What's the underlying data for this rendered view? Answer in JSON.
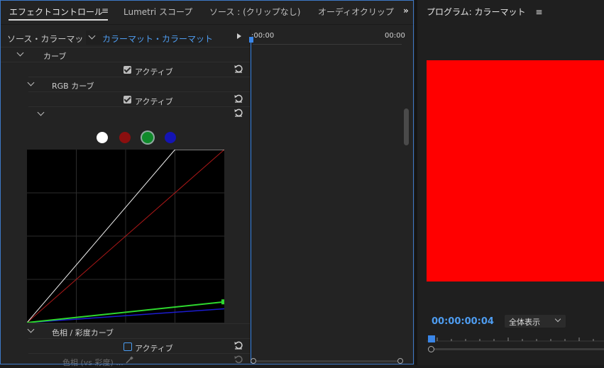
{
  "tabs": [
    {
      "label": "エフェクトコントロール",
      "active": true
    },
    {
      "label": "Lumetri スコープ",
      "active": false
    },
    {
      "label": "ソース : (クリップなし)",
      "active": false
    },
    {
      "label": "オーディオクリップ",
      "active": false
    }
  ],
  "tab_menu_glyph": "≡",
  "tabs_overflow_glyph": "»",
  "source": {
    "label": "ソース・カラーマット",
    "clip": "カラーマット・カラーマット"
  },
  "timeline": {
    "start": ":00:00",
    "end": "00:00"
  },
  "effects": {
    "curves": {
      "title": "カーブ",
      "active_label": "アクティブ",
      "active_checked": true
    },
    "rgb_curves": {
      "title": "RGB カーブ",
      "active_label": "アクティブ",
      "active_checked": true
    },
    "channel_dots": [
      {
        "name": "white",
        "color": "#ffffff",
        "selected": false
      },
      {
        "name": "red",
        "color": "#8b0f0f",
        "selected": false
      },
      {
        "name": "green",
        "color": "#0f8a2a",
        "selected": true
      },
      {
        "name": "blue",
        "color": "#1414b4",
        "selected": false
      }
    ],
    "hue_sat": {
      "title": "色相 / 彩度カーブ",
      "active_label": "アクティブ",
      "active_checked": false,
      "sub_label": "色相 (vs 彩度) ..."
    }
  },
  "curve_data": {
    "white": [
      [
        0,
        0
      ],
      [
        0.75,
        1
      ],
      [
        1,
        1
      ]
    ],
    "red": [
      [
        0,
        0
      ],
      [
        1,
        1
      ]
    ],
    "green": [
      [
        0,
        0
      ],
      [
        1,
        0.12
      ]
    ],
    "blue": [
      [
        0,
        0
      ],
      [
        1,
        0.08
      ]
    ]
  },
  "colors": {
    "accent": "#4e9cf0",
    "matte": "#ff0000"
  },
  "program": {
    "title": "プログラム: カラーマット",
    "menu_glyph": "≡",
    "timecode": "00:00:00:04",
    "zoom": "全体表示"
  }
}
